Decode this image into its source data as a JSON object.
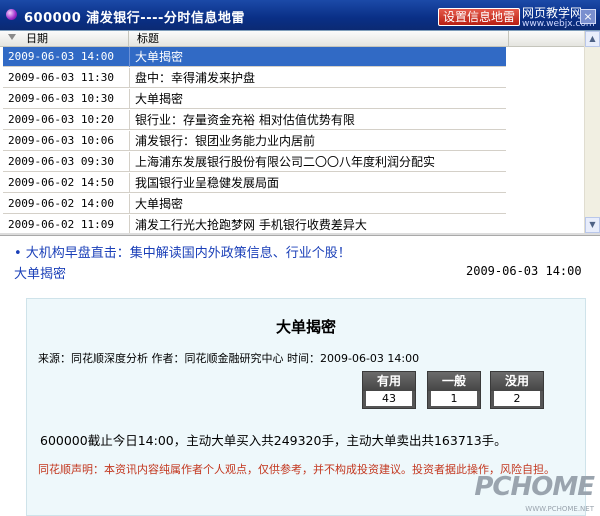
{
  "window": {
    "title": "600000 浦发银行----分时信息地雷",
    "settings_button": "设置信息地雷",
    "watermark_main": "网页教学网",
    "watermark_sub": "www.webjx.com",
    "close_glyph": "×"
  },
  "grid": {
    "columns": [
      "日期",
      "标题"
    ],
    "rows": [
      {
        "date": "2009-06-03 14:00",
        "title": "大单揭密",
        "selected": true
      },
      {
        "date": "2009-06-03 11:30",
        "title": "盘中：幸得浦发来护盘",
        "selected": false
      },
      {
        "date": "2009-06-03 10:30",
        "title": "大单揭密",
        "selected": false
      },
      {
        "date": "2009-06-03 10:20",
        "title": "银行业：存量资金充裕  相对估值优势有限",
        "selected": false
      },
      {
        "date": "2009-06-03 10:06",
        "title": "浦发银行：银团业务能力业内居前",
        "selected": false
      },
      {
        "date": "2009-06-03 09:30",
        "title": "上海浦东发展银行股份有限公司二〇〇八年度利润分配实",
        "selected": false
      },
      {
        "date": "2009-06-02 14:50",
        "title": "我国银行业呈稳健发展局面",
        "selected": false
      },
      {
        "date": "2009-06-02 14:00",
        "title": "大单揭密",
        "selected": false
      },
      {
        "date": "2009-06-02 11:09",
        "title": "浦发工行光大抢跑梦网  手机银行收费差异大",
        "selected": false
      }
    ]
  },
  "detail": {
    "promo": "• 大机构早盘直击：集中解读国内外政策信息、行业个股！",
    "title": "大单揭密",
    "time": "2009-06-03 14:00",
    "card": {
      "title": "大单揭密",
      "meta": "来源：同花顺深度分析    作者：同花顺金融研究中心    时间：2009-06-03 14:00",
      "votes": [
        {
          "label": "有用",
          "count": "43"
        },
        {
          "label": "一般",
          "count": "1"
        },
        {
          "label": "没用",
          "count": "2"
        }
      ],
      "body": "600000截止今日14:00，主动大单买入共249320手，主动大单卖出共163713手。",
      "disclaimer": "同花顺声明：本资讯内容纯属作者个人观点，仅供参考，并不构成投资建议。投资者据此操作，风险自担。"
    }
  },
  "logo": {
    "main": "PCHOME",
    "sub": "WWW.PCHOME.NET"
  }
}
